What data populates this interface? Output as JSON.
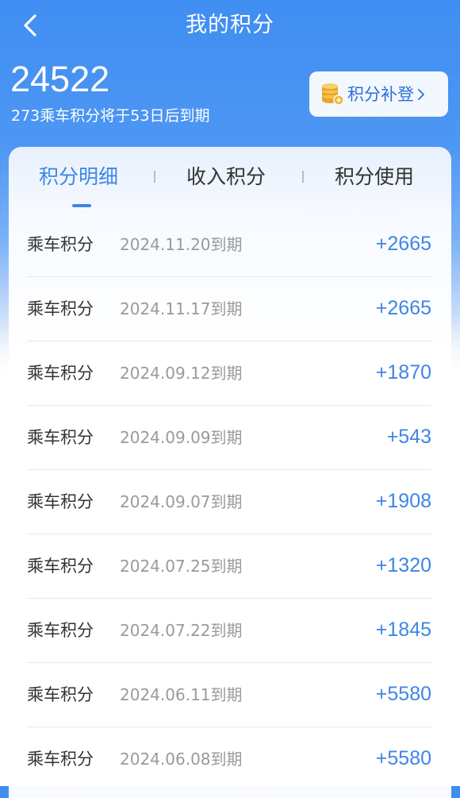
{
  "header": {
    "title": "我的积分",
    "back_icon": "chevron-left-icon"
  },
  "summary": {
    "total_points": "24522",
    "expire_note": "273乘车积分将于53日后到期",
    "supplement_button": {
      "label": "积分补登",
      "icon": "coins-icon",
      "arrow": "›"
    }
  },
  "tabs": [
    {
      "label": "积分明细",
      "active": true
    },
    {
      "label": "收入积分",
      "active": false
    },
    {
      "label": "积分使用",
      "active": false
    }
  ],
  "records": [
    {
      "type": "乘车积分",
      "date": "2024.11.20到期",
      "amount": "+2665"
    },
    {
      "type": "乘车积分",
      "date": "2024.11.17到期",
      "amount": "+2665"
    },
    {
      "type": "乘车积分",
      "date": "2024.09.12到期",
      "amount": "+1870"
    },
    {
      "type": "乘车积分",
      "date": "2024.09.09到期",
      "amount": "+543"
    },
    {
      "type": "乘车积分",
      "date": "2024.09.07到期",
      "amount": "+1908"
    },
    {
      "type": "乘车积分",
      "date": "2024.07.25到期",
      "amount": "+1320"
    },
    {
      "type": "乘车积分",
      "date": "2024.07.22到期",
      "amount": "+1845"
    },
    {
      "type": "乘车积分",
      "date": "2024.06.11到期",
      "amount": "+5580"
    },
    {
      "type": "乘车积分",
      "date": "2024.06.08到期",
      "amount": "+5580"
    }
  ],
  "colors": {
    "brand_blue": "#3f8ef2",
    "accent_blue": "#3d86e6",
    "supplement_text": "#2b6fd6",
    "coin_gold": "#f2b53a"
  }
}
